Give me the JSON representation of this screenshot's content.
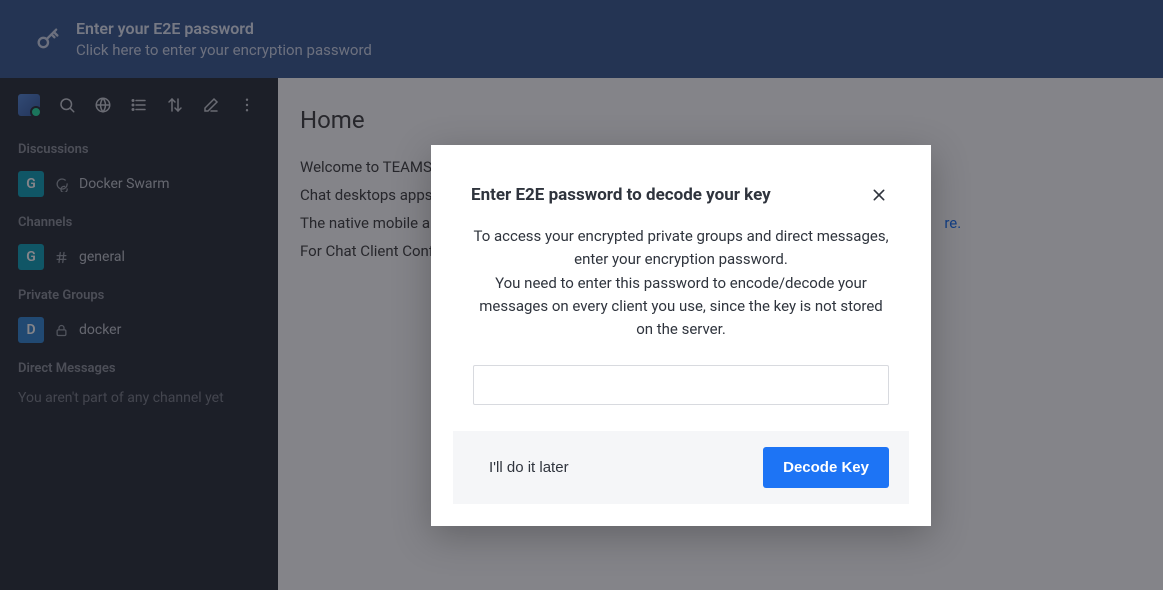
{
  "banner": {
    "title": "Enter your E2E password",
    "subtitle": "Click here to enter your encryption password"
  },
  "sidebar": {
    "sections": {
      "discussions": {
        "label": "Discussions",
        "item": {
          "badge": "G",
          "name": "Docker Swarm"
        }
      },
      "channels": {
        "label": "Channels",
        "item": {
          "badge": "G",
          "name": "general"
        }
      },
      "privateGroups": {
        "label": "Private Groups",
        "item": {
          "badge": "D",
          "name": "docker"
        }
      },
      "directMessages": {
        "label": "Direct Messages",
        "empty": "You aren't part of any channel yet"
      }
    }
  },
  "main": {
    "heading": "Home",
    "lines": {
      "l1": "Welcome to TEAMS-T",
      "l2": "Chat desktops apps fo",
      "l3a": "The native mobile app",
      "l3b": "re.",
      "l4": "For Chat Client Config"
    }
  },
  "modal": {
    "title": "Enter E2E password to decode your key",
    "body1": "To access your encrypted private groups and direct messages, enter your encryption password.",
    "body2": "You need to enter this password to encode/decode your messages on every client you use, since the key is not stored on the server.",
    "later": "I'll do it later",
    "decode": "Decode Key"
  }
}
